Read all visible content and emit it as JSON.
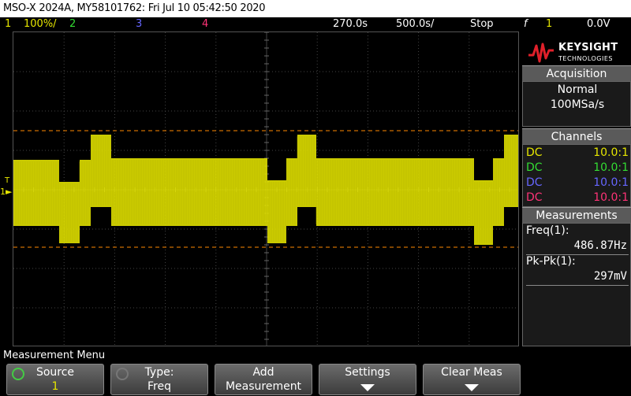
{
  "title": "MSO-X 2024A, MY58101762: Fri Jul 10 05:42:50 2020",
  "status": {
    "ch1_num": "1",
    "ch1_scale": "100%/",
    "ch2_num": "2",
    "ch3_num": "3",
    "ch4_num": "4",
    "time_delay": "270.0s",
    "time_scale": "500.0s/",
    "run_state": "Stop",
    "trigger_symbol": "f",
    "trigger_source": "1",
    "trigger_level": "0.0V"
  },
  "colors": {
    "ch1": "#e6e600",
    "ch2": "#33dd33",
    "ch3": "#6666ff",
    "ch4": "#ff3377",
    "cursor": "#ff8800",
    "keysight_red": "#e0202a"
  },
  "brand": {
    "name": "KEYSIGHT",
    "sub": "TECHNOLOGIES"
  },
  "acquisition": {
    "header": "Acquisition",
    "mode": "Normal",
    "rate": "100MSa/s"
  },
  "channels": {
    "header": "Channels",
    "rows": [
      {
        "coupling": "DC",
        "ratio": "10.0:1"
      },
      {
        "coupling": "DC",
        "ratio": "10.0:1"
      },
      {
        "coupling": "DC",
        "ratio": "10.0:1"
      },
      {
        "coupling": "DC",
        "ratio": "10.0:1"
      }
    ]
  },
  "measurements": {
    "header": "Measurements",
    "items": [
      {
        "label": "Freq(1):",
        "value": "486.87Hz"
      },
      {
        "label": "Pk-Pk(1):",
        "value": "297mV"
      }
    ]
  },
  "menu": {
    "title": "Measurement Menu",
    "keys": [
      {
        "line1": "Source",
        "line2": "1"
      },
      {
        "line1": "Type:",
        "line2": "Freq"
      },
      {
        "line1": "Add",
        "line2": "Measurement"
      },
      {
        "line1": "Settings",
        "line2": ""
      },
      {
        "line1": "Clear Meas",
        "line2": ""
      }
    ]
  },
  "edge_labels": {
    "trigger_marker": "T",
    "ch1_marker": "1"
  }
}
